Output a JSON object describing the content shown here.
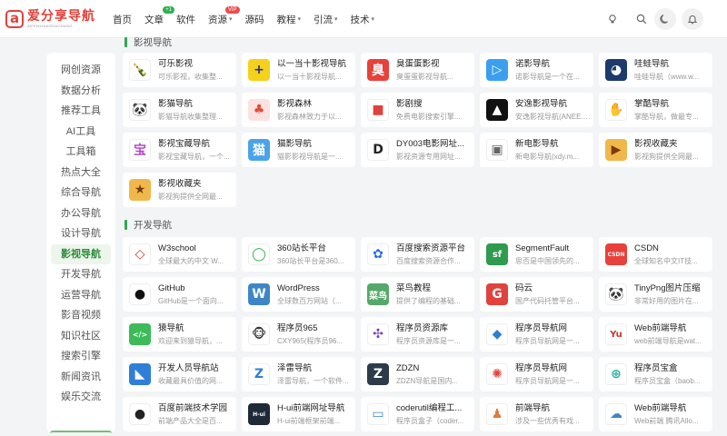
{
  "logo": {
    "mark": "a",
    "title": "爱分享导航",
    "subtitle": "AIFENXIANGDAOHANG"
  },
  "nav": [
    {
      "label": "首页"
    },
    {
      "label": "文章",
      "badge": "+1"
    },
    {
      "label": "软件"
    },
    {
      "label": "资源",
      "badge": "VIP",
      "dropdown": true
    },
    {
      "label": "源码"
    },
    {
      "label": "教程",
      "dropdown": true
    },
    {
      "label": "引流",
      "dropdown": true
    },
    {
      "label": "技术",
      "dropdown": true
    }
  ],
  "header_icons": [
    "lightbulb-icon",
    "search-icon",
    "moon-icon",
    "bell-icon"
  ],
  "sidebar": [
    "网创资源",
    "数据分析",
    "推荐工具",
    "AI工具",
    "工具箱",
    "热点大全",
    "综合导航",
    "办公导航",
    "设计导航",
    "影视导航",
    "开发导航",
    "运营导航",
    "影音视频",
    "知识社区",
    "搜索引擎",
    "新闻资讯",
    "娱乐交流"
  ],
  "sidebar_active": "影视导航",
  "sections": {
    "film": {
      "title": "影视导航"
    },
    "dev": {
      "title": "开发导航"
    }
  },
  "film_cards": [
    {
      "title": "可乐影视",
      "desc": "可乐影视，收集整...",
      "icon": "cola-bottle-icon",
      "bg": "#ffffff",
      "fg": "#5a3a1a",
      "glyph": "🍾"
    },
    {
      "title": "以一当十影视导航",
      "desc": "以一当十影视导航...",
      "icon": "plus-logo-icon",
      "bg": "#f6d11b",
      "fg": "#2b2b86",
      "glyph": "+"
    },
    {
      "title": "臭蛋蛋影视",
      "desc": "臭蛋蛋影视导航...",
      "icon": "chou-logo-icon",
      "bg": "#e8413b",
      "fg": "#ffffff",
      "glyph": "臭"
    },
    {
      "title": "诺影导航",
      "desc": "诺影导航是一个在...",
      "icon": "play-logo-icon",
      "bg": "#3b9ff0",
      "fg": "#ffffff",
      "glyph": "▷"
    },
    {
      "title": "哇蛙导航",
      "desc": "哇蛙导航（www.w...",
      "icon": "frog-logo-icon",
      "bg": "#1c3a6b",
      "fg": "#ffffff",
      "glyph": "◕"
    },
    {
      "title": "影猫导航",
      "desc": "影猫导航收集整理...",
      "icon": "panda-logo-icon",
      "bg": "#ffffff",
      "fg": "#222222",
      "glyph": "🐼"
    },
    {
      "title": "影视森林",
      "desc": "影视森林致力于以...",
      "icon": "tree-logo-icon",
      "bg": "#fbe2e0",
      "fg": "#e04b3c",
      "glyph": "♣"
    },
    {
      "title": "影剧搜",
      "desc": "免费电影搜索引擎...",
      "icon": "camera-logo-icon",
      "bg": "#ffffff",
      "fg": "#e0423c",
      "glyph": "■"
    },
    {
      "title": "安逸影视导航",
      "desc": "安逸影视导航(ANEE.C...",
      "icon": "arrow-logo-icon",
      "bg": "#111111",
      "fg": "#ffffff",
      "glyph": "▲"
    },
    {
      "title": "掌酷导航",
      "desc": "掌酷导航，做最专...",
      "icon": "hand-logo-icon",
      "bg": "#ffffff",
      "fg": "#4b8ad8",
      "glyph": "✋"
    },
    {
      "title": "影视宝藏导航",
      "desc": "影视宝藏导航，一个...",
      "icon": "bao-logo-icon",
      "bg": "#ffffff",
      "fg": "#b44bc9",
      "glyph": "宝"
    },
    {
      "title": "猫影导航",
      "desc": "猫影影视导航是一...",
      "icon": "cat-logo-icon",
      "bg": "#4aa3ea",
      "fg": "#ffffff",
      "glyph": "猫"
    },
    {
      "title": "DY003电影网址...",
      "desc": "影视资源专用网址...",
      "icon": "dy-logo-icon",
      "bg": "#ffffff",
      "fg": "#222222",
      "glyph": "D"
    },
    {
      "title": "新电影导航",
      "desc": "新电影导航(xdy.m...",
      "icon": "browser-logo-icon",
      "bg": "#ffffff",
      "fg": "#666666",
      "glyph": "▣"
    },
    {
      "title": "影视收藏夹",
      "desc": "影视狗提供全网最...",
      "icon": "fav-logo-icon",
      "bg": "#f0b84b",
      "fg": "#7a3a10",
      "glyph": "▶"
    },
    {
      "title": "影视收藏夹",
      "desc": "影视狗提供全网最...",
      "icon": "fav-logo-icon",
      "bg": "#f0b84b",
      "fg": "#7a3a10",
      "glyph": "★"
    }
  ],
  "dev_cards": [
    {
      "title": "W3school",
      "desc": "全球最大的中文 W...",
      "icon": "w3-logo-icon",
      "bg": "#ffffff",
      "fg": "#c0392b",
      "glyph": "◇"
    },
    {
      "title": "360站长平台",
      "desc": "360站长平台是360...",
      "icon": "360-logo-icon",
      "bg": "#ffffff",
      "fg": "#2bb24c",
      "glyph": "◯"
    },
    {
      "title": "百度搜索资源平台",
      "desc": "百度搜索资源合作...",
      "icon": "baidu-paw-icon",
      "bg": "#ffffff",
      "fg": "#2f6fd8",
      "glyph": "✿"
    },
    {
      "title": "SegmentFault",
      "desc": "思否是中国领先的...",
      "icon": "sf-logo-icon",
      "bg": "#2e9b4e",
      "fg": "#ffffff",
      "glyph": "sf"
    },
    {
      "title": "CSDN",
      "desc": "全球知名中文IT技...",
      "icon": "csdn-logo-icon",
      "bg": "#e8413b",
      "fg": "#ffffff",
      "glyph": "CSDN"
    },
    {
      "title": "GitHub",
      "desc": "GitHub是一个面向...",
      "icon": "github-logo-icon",
      "bg": "#ffffff",
      "fg": "#111111",
      "glyph": "●"
    },
    {
      "title": "WordPress",
      "desc": "全球数百万网站（...",
      "icon": "wordpress-logo-icon",
      "bg": "#3d86c6",
      "fg": "#ffffff",
      "glyph": "W"
    },
    {
      "title": "菜鸟教程",
      "desc": "提供了编程的基础...",
      "icon": "runoob-logo-icon",
      "bg": "#56a86a",
      "fg": "#ffffff",
      "glyph": "菜鸟"
    },
    {
      "title": "码云",
      "desc": "国产代码托管平台...",
      "icon": "gitee-logo-icon",
      "bg": "#e0423c",
      "fg": "#ffffff",
      "glyph": "G"
    },
    {
      "title": "TinyPng图片压缩",
      "desc": "非常好用的图片在...",
      "icon": "panda-logo-icon",
      "bg": "#ffffff",
      "fg": "#222222",
      "glyph": "🐼"
    },
    {
      "title": "猿导航",
      "desc": "欢迎来到猿导航，...",
      "icon": "code-bubble-icon",
      "bg": "#3dba5a",
      "fg": "#ffffff",
      "glyph": "</>"
    },
    {
      "title": "程序员965",
      "desc": "CXY965(程序员96...",
      "icon": "monkey-logo-icon",
      "bg": "#ffffff",
      "fg": "#333333",
      "glyph": "🐵"
    },
    {
      "title": "程序员资源库",
      "desc": "程序员资源库是一...",
      "icon": "puzzle-logo-icon",
      "bg": "#ffffff",
      "fg": "#7a3fc4",
      "glyph": "✣"
    },
    {
      "title": "程序员导航网",
      "desc": "程序员导航网是一...",
      "icon": "cube-logo-icon",
      "bg": "#ffffff",
      "fg": "#2f7fd8",
      "glyph": "◆"
    },
    {
      "title": "Web前端导航",
      "desc": "web前端导航是wat...",
      "icon": "yu-logo-icon",
      "bg": "#ffffff",
      "fg": "#c0392b",
      "glyph": "Yu"
    },
    {
      "title": "开发人员导航站",
      "desc": "收藏最具价值的网...",
      "icon": "chart-logo-icon",
      "bg": "#2f7fd8",
      "fg": "#ffffff",
      "glyph": "◣"
    },
    {
      "title": "泽雷导航",
      "desc": "泽雷导航，一个软件...",
      "icon": "z-logo-icon",
      "bg": "#ffffff",
      "fg": "#2f7fd8",
      "glyph": "Z"
    },
    {
      "title": "ZDZN",
      "desc": "ZDZN导航是国内...",
      "icon": "zdzn-logo-icon",
      "bg": "#2d3a4a",
      "fg": "#ffffff",
      "glyph": "Z"
    },
    {
      "title": "程序员导航网",
      "desc": "程序员导航网是一...",
      "icon": "flower-logo-icon",
      "bg": "#ffffff",
      "fg": "#e0423c",
      "glyph": "✺"
    },
    {
      "title": "程序员宝盒",
      "desc": "程序员宝盒（baob...",
      "icon": "box-logo-icon",
      "bg": "#ffffff",
      "fg": "#2bb2a4",
      "glyph": "⊕"
    },
    {
      "title": "百度前端技术学园",
      "desc": "前端产品大全是百...",
      "icon": "orb-logo-icon",
      "bg": "#ffffff",
      "fg": "#222222",
      "glyph": "●"
    },
    {
      "title": "H-ui前端网址导航",
      "desc": "H-ui前端框架前端...",
      "icon": "hui-logo-icon",
      "bg": "#1e2a38",
      "fg": "#ffffff",
      "glyph": "H-ui"
    },
    {
      "title": "coderutil编程工...",
      "desc": "程序员盒子（coder...",
      "icon": "tools-logo-icon",
      "bg": "#ffffff",
      "fg": "#3d86c6",
      "glyph": "▭"
    },
    {
      "title": "前端导航",
      "desc": "涉及一些优秀有戏...",
      "icon": "people-logo-icon",
      "bg": "#ffffff",
      "fg": "#e07a3c",
      "glyph": "♟"
    },
    {
      "title": "Web前端导航",
      "desc": "Web前端 腾讯Allo...",
      "icon": "cloud-logo-icon",
      "bg": "#ffffff",
      "fg": "#3d86c6",
      "glyph": "☁"
    }
  ]
}
